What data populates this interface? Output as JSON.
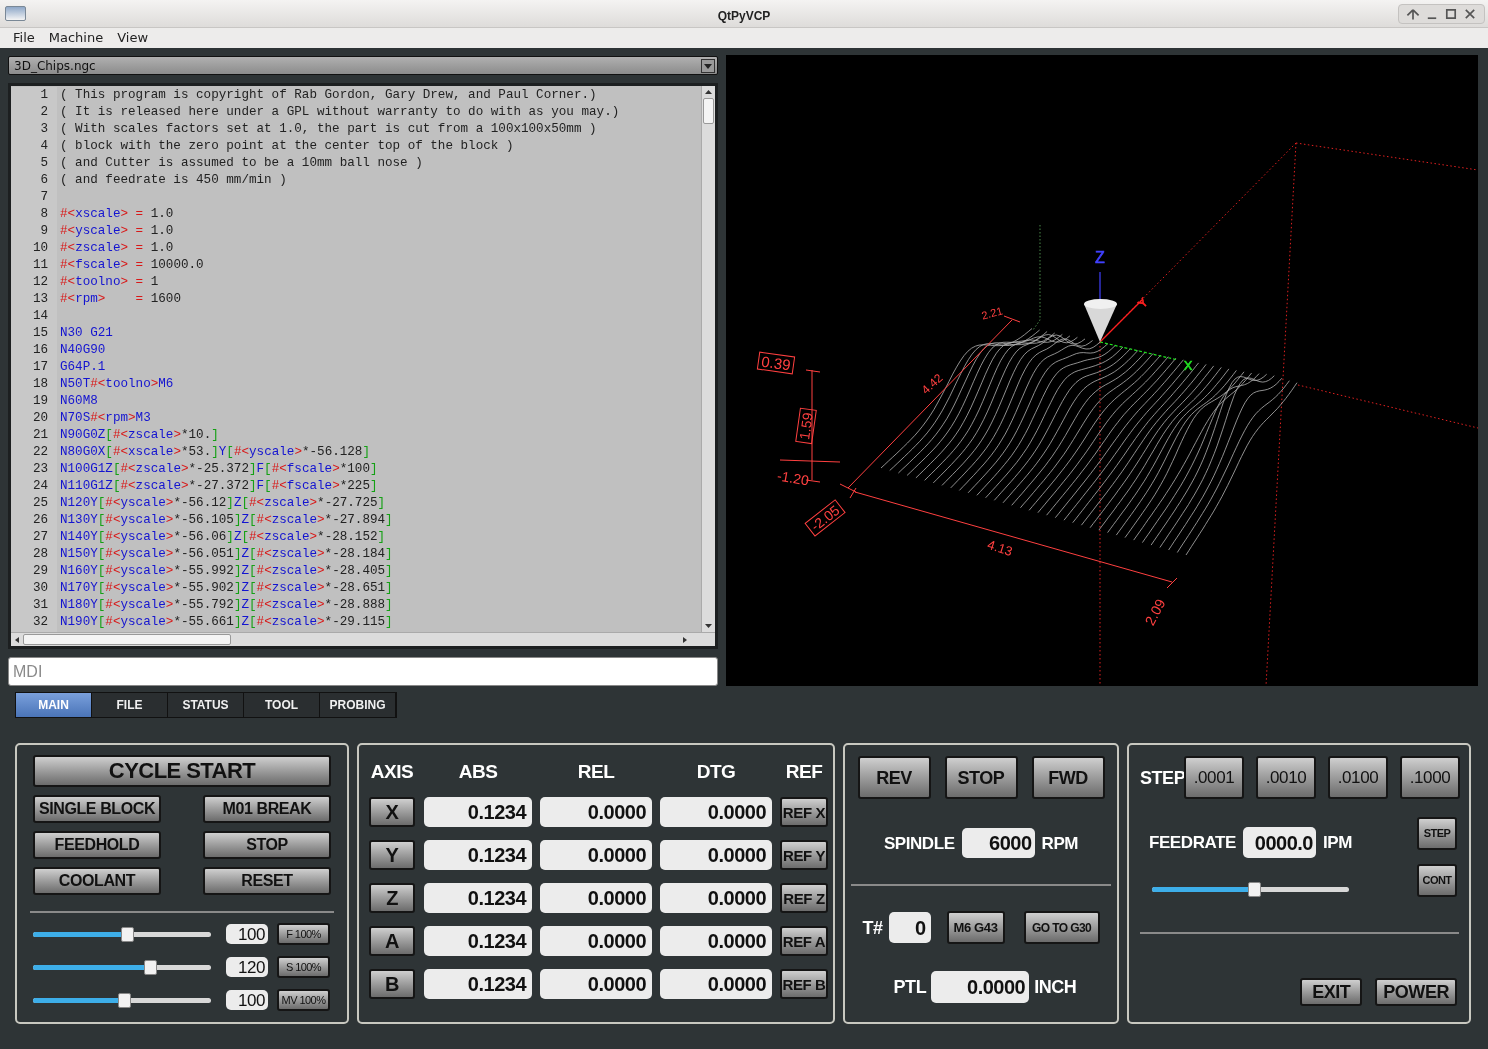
{
  "window": {
    "title": "QtPyVCP"
  },
  "menu": [
    "File",
    "Machine",
    "View"
  ],
  "file_selector": {
    "value": "3D_Chips.ngc"
  },
  "editor": {
    "lines": [
      {
        "number": "1",
        "code": "( This program is copyright of Rab Gordon, Gary Drew, and Paul Corner.)"
      },
      {
        "number": "2",
        "code": "( It is released here under a GPL without warranty to do with as you may.)"
      },
      {
        "number": "3",
        "code": "( With scales factors set at 1.0, the part is cut from a 100x100x50mm )"
      },
      {
        "number": "4",
        "code": "( block with the zero point at the center top of the block )"
      },
      {
        "number": "5",
        "code": "( and Cutter is assumed to be a 10mm ball nose )"
      },
      {
        "number": "6",
        "code": "( and feedrate is 450 mm/min )"
      },
      {
        "number": "7"
      },
      {
        "number": "8",
        "code": "#<xscale> = 1.0"
      },
      {
        "number": "9",
        "code": "#<yscale> = 1.0"
      },
      {
        "number": "10",
        "code": "#<zscale> = 1.0"
      },
      {
        "number": "11",
        "code": "#<fscale> = 10000.0"
      },
      {
        "number": "12",
        "code": "#<toolno> = 1"
      },
      {
        "number": "13",
        "code": "#<rpm>    = 1600"
      },
      {
        "number": "14"
      },
      {
        "number": "15",
        "code": "N30 G21"
      },
      {
        "number": "16",
        "code": "N40G90"
      },
      {
        "number": "17",
        "code": "G64P.1"
      },
      {
        "number": "18",
        "code": "N50T#<toolno>M6"
      },
      {
        "number": "19",
        "code": "N60M8"
      },
      {
        "number": "20",
        "code": "N70S#<rpm>M3"
      },
      {
        "number": "21",
        "code": "N90G0Z[#<zscale>*10.]"
      },
      {
        "number": "22",
        "code": "N80G0X[#<xscale>*53.]Y[#<yscale>*-56.128]"
      },
      {
        "number": "23",
        "code": "N100G1Z[#<zscale>*-25.372]F[#<fscale>*100]"
      },
      {
        "number": "24",
        "code": "N110G1Z[#<zscale>*-27.372]F[#<fscale>*225]"
      },
      {
        "number": "25",
        "code": "N120Y[#<yscale>*-56.12]Z[#<zscale>*-27.725]"
      },
      {
        "number": "26",
        "code": "N130Y[#<yscale>*-56.105]Z[#<zscale>*-27.894]"
      },
      {
        "number": "27",
        "code": "N140Y[#<yscale>*-56.06]Z[#<zscale>*-28.152]"
      },
      {
        "number": "28",
        "code": "N150Y[#<yscale>*-56.051]Z[#<zscale>*-28.184]"
      },
      {
        "number": "29",
        "code": "N160Y[#<yscale>*-55.992]Z[#<zscale>*-28.405]"
      },
      {
        "number": "30",
        "code": "N170Y[#<yscale>*-55.902]Z[#<zscale>*-28.651]"
      },
      {
        "number": "31",
        "code": "N180Y[#<yscale>*-55.792]Z[#<zscale>*-28.888]"
      },
      {
        "number": "32",
        "code": "N190Y[#<yscale>*-55.661]Z[#<zscale>*-29.115]"
      }
    ]
  },
  "mdi": {
    "placeholder": "MDI"
  },
  "viewport": {
    "labels": [
      {
        "kind": "axis",
        "text": "Z",
        "color": "#4040ff"
      },
      {
        "kind": "axis",
        "text": "Y",
        "color": "#ff2020"
      },
      {
        "kind": "axis",
        "text": "X",
        "color": "#20e020"
      },
      {
        "kind": "dimension",
        "text": "2.21",
        "boxed": false
      },
      {
        "kind": "dimension",
        "text": "4.42",
        "boxed": false
      },
      {
        "kind": "dimension",
        "text": "0.39",
        "boxed": true
      },
      {
        "kind": "dimension",
        "text": "1.59",
        "boxed": true
      },
      {
        "kind": "dimension",
        "text": "-1.20",
        "boxed": false
      },
      {
        "kind": "dimension",
        "text": "-2.05",
        "boxed": true
      },
      {
        "kind": "dimension",
        "text": "4.13",
        "boxed": false
      },
      {
        "kind": "dimension",
        "text": "2.09",
        "boxed": false
      }
    ]
  },
  "tabs": [
    {
      "label": "MAIN",
      "selected": true
    },
    {
      "label": "FILE",
      "selected": false
    },
    {
      "label": "STATUS",
      "selected": false
    },
    {
      "label": "TOOL",
      "selected": false
    },
    {
      "label": "PROBING",
      "selected": false
    }
  ],
  "program_panel": {
    "cycle_start": "CYCLE START",
    "buttons": [
      "SINGLE BLOCK",
      "M01 BREAK",
      "FEEDHOLD",
      "STOP",
      "COOLANT",
      "RESET"
    ],
    "overrides": [
      {
        "level": 0.53,
        "value": "100",
        "button": "F 100%"
      },
      {
        "level": 0.66,
        "value": "120",
        "button": "S 100%"
      },
      {
        "level": 0.51,
        "value": "100",
        "button": "MV 100%"
      }
    ]
  },
  "dro": {
    "columns": [
      "AXIS",
      "ABS",
      "REL",
      "DTG",
      "REF"
    ],
    "rows": [
      {
        "axis": "X",
        "abs": "0.1234",
        "rel": "0.0000",
        "dtg": "0.0000",
        "ref": "REF X"
      },
      {
        "axis": "Y",
        "abs": "0.1234",
        "rel": "0.0000",
        "dtg": "0.0000",
        "ref": "REF Y"
      },
      {
        "axis": "Z",
        "abs": "0.1234",
        "rel": "0.0000",
        "dtg": "0.0000",
        "ref": "REF Z"
      },
      {
        "axis": "A",
        "abs": "0.1234",
        "rel": "0.0000",
        "dtg": "0.0000",
        "ref": "REF A"
      },
      {
        "axis": "B",
        "abs": "0.1234",
        "rel": "0.0000",
        "dtg": "0.0000",
        "ref": "REF B"
      }
    ]
  },
  "spindle_panel": {
    "direction_buttons": [
      "REV",
      "STOP",
      "FWD"
    ],
    "spindle_label": "SPINDLE",
    "spindle_value": "6000",
    "spindle_unit": "RPM",
    "tool_label": "T#",
    "tool_value": "0",
    "tool_buttons": [
      "M6 G43",
      "GO TO G30"
    ],
    "ptl_label": "PTL",
    "ptl_value": "0.0000",
    "ptl_unit": "INCH"
  },
  "jog_panel": {
    "step_label": "STEP",
    "step_buttons": [
      ".0001",
      ".0010",
      ".0100",
      ".1000"
    ],
    "feedrate_label": "FEEDRATE",
    "feedrate_value": "0000.0",
    "feedrate_unit": "IPM",
    "mode_buttons": [
      "STEP",
      "CONT"
    ],
    "feedrate_slider": {
      "level": 0.52
    },
    "buttons": [
      "EXIT",
      "POWER"
    ]
  }
}
